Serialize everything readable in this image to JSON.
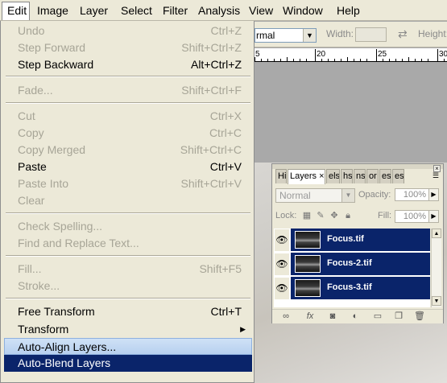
{
  "menubar": {
    "items": [
      "Edit",
      "Image",
      "Layer",
      "Select",
      "Filter",
      "Analysis",
      "View",
      "Window",
      "Help"
    ]
  },
  "options_bar": {
    "mode_value": "rmal",
    "width_label": "Width:",
    "height_label": "Height:"
  },
  "ruler": {
    "ticks": [
      "5",
      "20",
      "25",
      "30"
    ]
  },
  "edit_menu": {
    "undo": {
      "label": "Undo",
      "shortcut": "Ctrl+Z"
    },
    "step_forward": {
      "label": "Step Forward",
      "shortcut": "Shift+Ctrl+Z"
    },
    "step_backward": {
      "label": "Step Backward",
      "shortcut": "Alt+Ctrl+Z"
    },
    "fade": {
      "label": "Fade...",
      "shortcut": "Shift+Ctrl+F"
    },
    "cut": {
      "label": "Cut",
      "shortcut": "Ctrl+X"
    },
    "copy": {
      "label": "Copy",
      "shortcut": "Ctrl+C"
    },
    "copy_merged": {
      "label": "Copy Merged",
      "shortcut": "Shift+Ctrl+C"
    },
    "paste": {
      "label": "Paste",
      "shortcut": "Ctrl+V"
    },
    "paste_into": {
      "label": "Paste Into",
      "shortcut": "Shift+Ctrl+V"
    },
    "clear": {
      "label": "Clear"
    },
    "check_spelling": {
      "label": "Check Spelling..."
    },
    "find_replace": {
      "label": "Find and Replace Text..."
    },
    "fill": {
      "label": "Fill...",
      "shortcut": "Shift+F5"
    },
    "stroke": {
      "label": "Stroke..."
    },
    "free_transform": {
      "label": "Free Transform",
      "shortcut": "Ctrl+T"
    },
    "transform": {
      "label": "Transform"
    },
    "auto_align": {
      "label": "Auto-Align Layers..."
    },
    "auto_blend": {
      "label": "Auto-Blend Layers"
    }
  },
  "layers_panel": {
    "tabs": [
      "Hi",
      "Layers",
      "els",
      "hs",
      "ns",
      "or",
      "es",
      "es"
    ],
    "blend_mode": "Normal",
    "opacity_label": "Opacity:",
    "opacity_value": "100%",
    "lock_label": "Lock:",
    "fill_label": "Fill:",
    "fill_value": "100%",
    "layers": [
      {
        "name": "Focus.tif"
      },
      {
        "name": "Focus-2.tif"
      },
      {
        "name": "Focus-3.tif"
      }
    ]
  },
  "colors": {
    "menu_bg": "#ece9d8",
    "selection": "#0a246a",
    "hover": "#c1d6f1"
  }
}
